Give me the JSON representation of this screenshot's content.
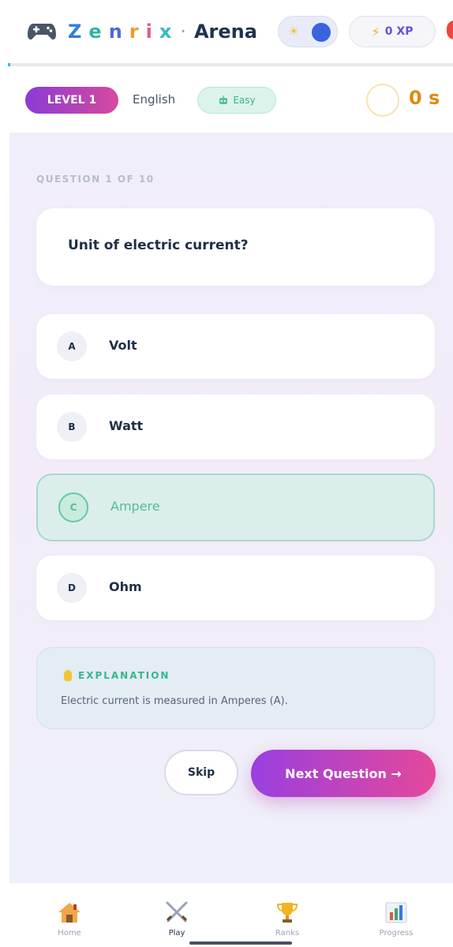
{
  "header": {
    "brand_letters": [
      {
        "char": "Z",
        "color": "#2f7fd8"
      },
      {
        "char": "e",
        "color": "#2bb5a0"
      },
      {
        "char": "n",
        "color": "#4a6ad8"
      },
      {
        "char": "r",
        "color": "#f09a2a"
      },
      {
        "char": "i",
        "color": "#e05a8f"
      },
      {
        "char": "x",
        "color": "#3ab8c8"
      }
    ],
    "brand_separator": "·",
    "brand_suffix": "Arena",
    "theme_sun_glyph": "☀",
    "xp_glyph": "⚡",
    "xp_label": "0 XP",
    "progress_fraction": 0.0
  },
  "info": {
    "level": "LEVEL 1",
    "language": "English",
    "difficulty_icon": "robot-icon",
    "difficulty": "Easy",
    "timer": "0 s"
  },
  "quiz": {
    "counter": "QUESTION 1 OF 10",
    "question": "Unit of electric current?",
    "options": [
      {
        "letter": "A",
        "text": "Volt",
        "selected": false
      },
      {
        "letter": "B",
        "text": "Watt",
        "selected": false
      },
      {
        "letter": "C",
        "text": "Ampere",
        "selected": true
      },
      {
        "letter": "D",
        "text": "Ohm",
        "selected": false
      }
    ],
    "explanation_title": "EXPLANATION",
    "explanation_text": "Electric current is measured in Amperes (A).",
    "skip_label": "Skip",
    "next_label": "Next Question →"
  },
  "nav": {
    "items": [
      {
        "label": "Home",
        "icon": "home-icon",
        "active": false
      },
      {
        "label": "Play",
        "icon": "swords-icon",
        "active": true
      },
      {
        "label": "Ranks",
        "icon": "trophy-icon",
        "active": false
      },
      {
        "label": "Progress",
        "icon": "bar-chart-icon",
        "active": false
      }
    ]
  },
  "colors": {
    "accent_gradient_start": "#9a3fe0",
    "accent_gradient_end": "#e4489a",
    "selected_green": "#4fbf97",
    "timer_orange": "#e08a10"
  }
}
